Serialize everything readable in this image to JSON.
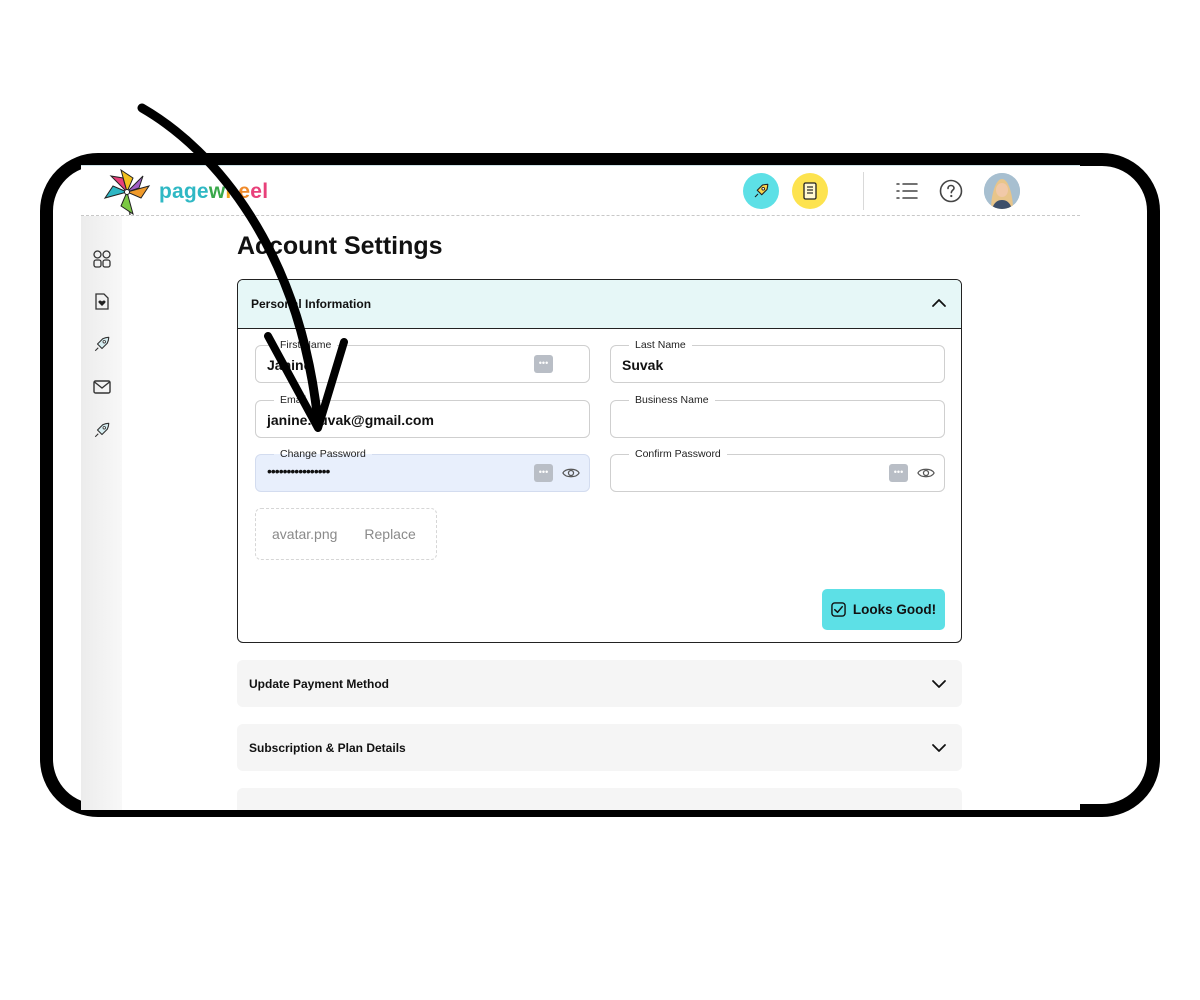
{
  "app": {
    "logo_text": "pagewheel"
  },
  "page": {
    "title": "Account Settings"
  },
  "sections": {
    "personal": {
      "title": "Personal Information",
      "expanded": true,
      "fields": {
        "first_name": {
          "label": "First Name",
          "value": "Janine"
        },
        "last_name": {
          "label": "Last Name",
          "value": "Suvak"
        },
        "email": {
          "label": "Email",
          "value": "janine.suvak@gmail.com"
        },
        "business_name": {
          "label": "Business Name",
          "value": ""
        },
        "change_password": {
          "label": "Change Password",
          "value": "••••••••••••••••"
        },
        "confirm_password": {
          "label": "Confirm Password",
          "value": ""
        }
      },
      "upload": {
        "filename": "avatar.png",
        "replace_label": "Replace"
      },
      "submit_label": "Looks Good!"
    },
    "payment": {
      "title": "Update Payment Method"
    },
    "subscription": {
      "title": "Subscription & Plan Details"
    }
  },
  "icons": {
    "topbar": [
      "rocket-icon",
      "document-icon",
      "list-icon",
      "help-icon",
      "avatar"
    ],
    "sidebar": [
      "grid-icon",
      "heart-document-icon",
      "rocket-icon",
      "mail-icon",
      "rocket-icon"
    ]
  },
  "colors": {
    "accent_cyan": "#5de0e6",
    "accent_yellow": "#fde34f",
    "panel_header": "#e6f7f7",
    "active_field": "#e8effc"
  }
}
